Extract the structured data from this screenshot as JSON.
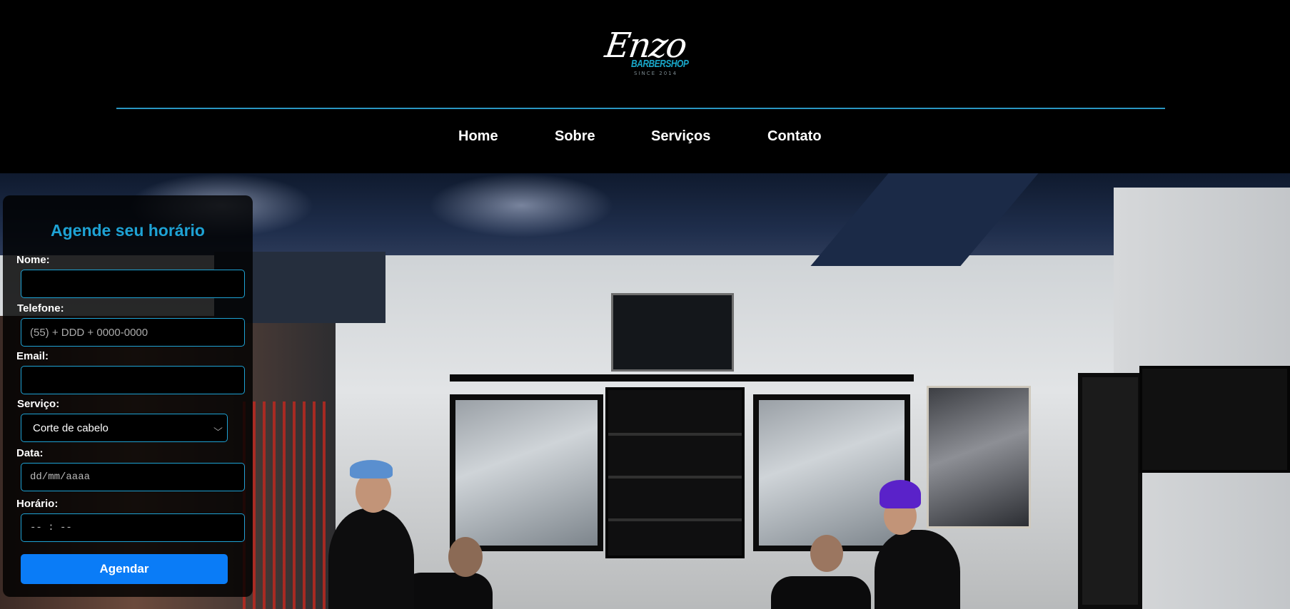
{
  "brand": {
    "logo_script": "Enzo",
    "logo_sub": "BARBERSHOP",
    "logo_since": "SINCE 2014"
  },
  "nav": {
    "items": [
      {
        "label": "Home"
      },
      {
        "label": "Sobre"
      },
      {
        "label": "Serviços"
      },
      {
        "label": "Contato"
      }
    ]
  },
  "hero": {
    "image": "barbershop-interior-photo"
  },
  "booking_form": {
    "title": "Agende seu horário",
    "fields": {
      "name": {
        "label": "Nome:",
        "value": "",
        "placeholder": ""
      },
      "phone": {
        "label": "Telefone:",
        "value": "",
        "placeholder": "(55) + DDD + 0000-0000"
      },
      "email": {
        "label": "Email:",
        "value": "",
        "placeholder": ""
      },
      "service": {
        "label": "Serviço:",
        "selected": "Corte de cabelo"
      },
      "date": {
        "label": "Data:",
        "placeholder": "dd/mm/aaaa"
      },
      "time": {
        "label": "Horário:",
        "placeholder": "-- : --"
      }
    },
    "submit_label": "Agendar"
  },
  "colors": {
    "accent": "#1ea2d4",
    "button": "#0a7cf7",
    "background": "#000000"
  }
}
